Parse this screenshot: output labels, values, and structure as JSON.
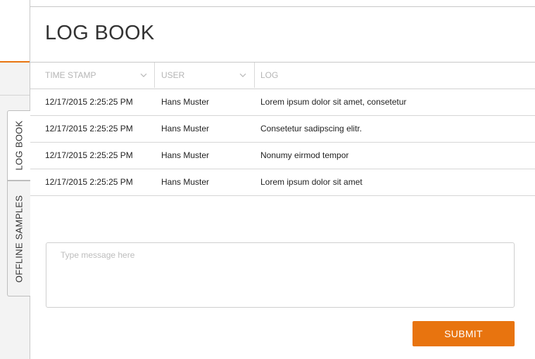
{
  "header": {
    "title": "LOG BOOK"
  },
  "side_tabs": {
    "log_book": "LOG BOOK",
    "offline_samples": "OFFLINE SAMPLES"
  },
  "table": {
    "columns": [
      {
        "label": "TIME STAMP",
        "icon": "chevron-down-icon"
      },
      {
        "label": "USER",
        "icon": "chevron-down-icon"
      },
      {
        "label": "LOG"
      }
    ],
    "rows": [
      {
        "timestamp": "12/17/2015 2:25:25 PM",
        "user": "Hans Muster",
        "log": "Lorem ipsum dolor sit amet, consetetur"
      },
      {
        "timestamp": "12/17/2015 2:25:25 PM",
        "user": "Hans Muster",
        "log": "Consetetur sadipscing elitr."
      },
      {
        "timestamp": "12/17/2015 2:25:25 PM",
        "user": "Hans Muster",
        "log": "Nonumy eirmod tempor"
      },
      {
        "timestamp": "12/17/2015 2:25:25 PM",
        "user": "Hans Muster",
        "log": "Lorem ipsum dolor sit amet"
      }
    ]
  },
  "message": {
    "value": "",
    "placeholder": "Type message here"
  },
  "actions": {
    "submit_label": "SUBMIT"
  },
  "colors": {
    "accent": "#e8740f",
    "border": "#c8c8c8",
    "sidebar_bg": "#f3f3f3"
  }
}
